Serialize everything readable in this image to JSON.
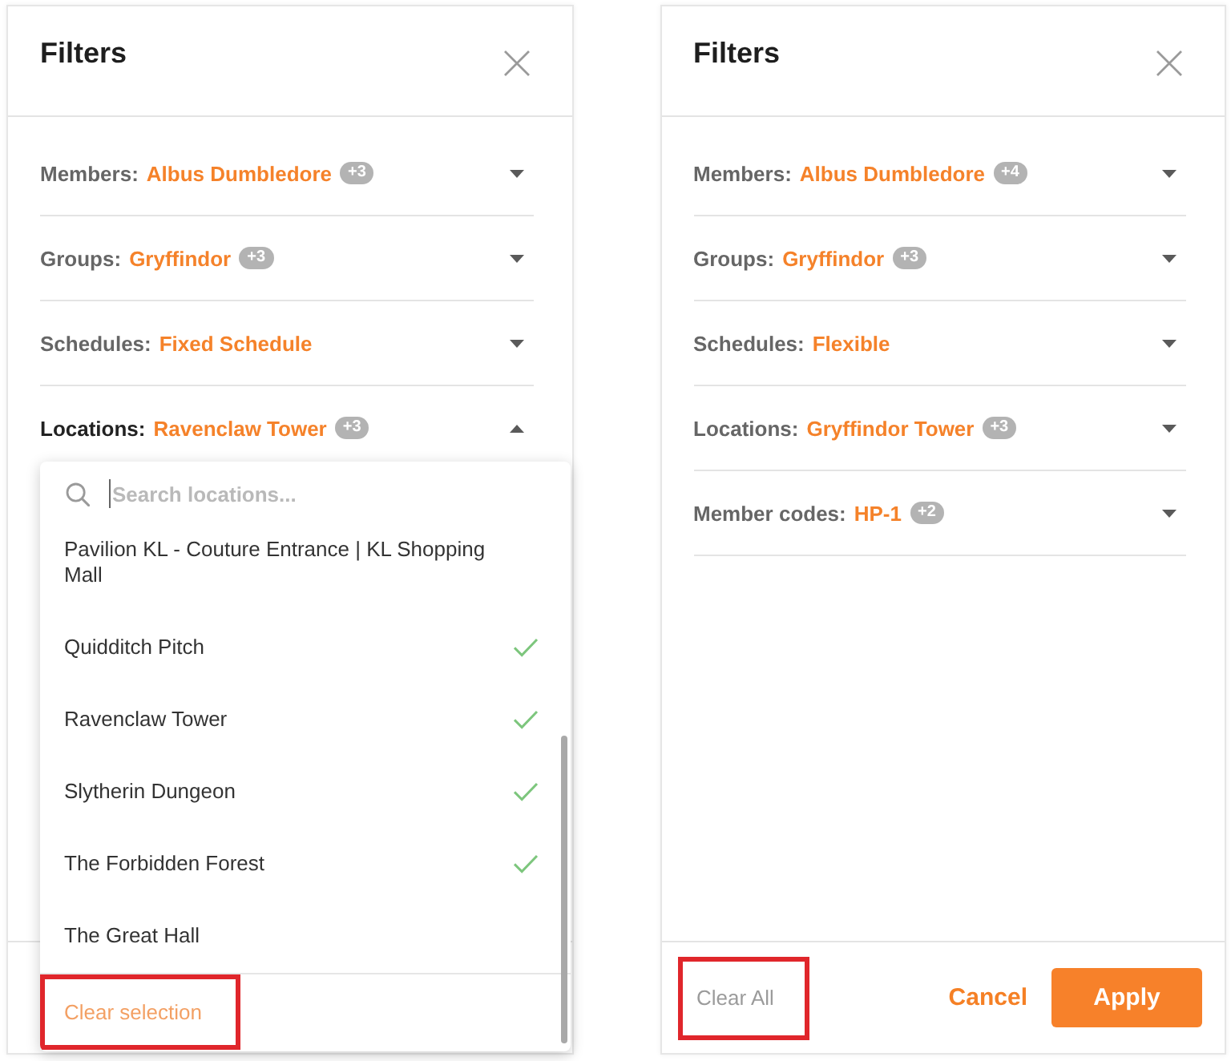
{
  "panels": [
    {
      "title": "Filters",
      "filters": [
        {
          "label": "Members:",
          "value": "Albus Dumbledore",
          "count": "+3",
          "expanded": false
        },
        {
          "label": "Groups:",
          "value": "Gryffindor",
          "count": "+3",
          "expanded": false
        },
        {
          "label": "Schedules:",
          "value": "Fixed Schedule",
          "expanded": false
        },
        {
          "label": "Locations:",
          "value": "Ravenclaw Tower",
          "count": "+3",
          "expanded": true,
          "dropdown": {
            "search": {
              "placeholder": "Search locations..."
            },
            "options": [
              {
                "label": "Pavilion KL - Couture Entrance | KL Shopping Mall",
                "selected": false
              },
              {
                "label": "Quidditch Pitch",
                "selected": true
              },
              {
                "label": "Ravenclaw Tower",
                "selected": true
              },
              {
                "label": "Slytherin Dungeon",
                "selected": true
              },
              {
                "label": "The Forbidden Forest",
                "selected": true
              },
              {
                "label": "The Great Hall",
                "selected": false
              }
            ],
            "clear_selection": {
              "label": "Clear selection",
              "highlighted": true
            }
          }
        }
      ]
    },
    {
      "title": "Filters",
      "filters": [
        {
          "label": "Members:",
          "value": "Albus Dumbledore",
          "count": "+4",
          "expanded": false
        },
        {
          "label": "Groups:",
          "value": "Gryffindor",
          "count": "+3",
          "expanded": false
        },
        {
          "label": "Schedules:",
          "value": "Flexible",
          "expanded": false
        },
        {
          "label": "Locations:",
          "value": "Gryffindor Tower",
          "count": "+3",
          "expanded": false
        },
        {
          "label": "Member codes:",
          "value": "HP-1",
          "count": "+2",
          "expanded": false
        }
      ],
      "footer": {
        "clear_all": {
          "label": "Clear All",
          "highlighted": true
        },
        "cancel": {
          "label": "Cancel"
        },
        "apply": {
          "label": "Apply"
        }
      }
    }
  ]
}
